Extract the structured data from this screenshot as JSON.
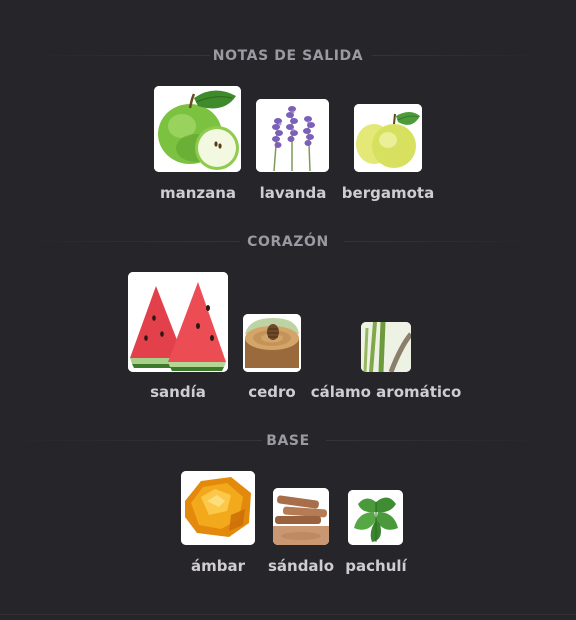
{
  "sections": [
    {
      "title": "NOTAS DE SALIDA",
      "notes": [
        {
          "name": "manzana",
          "icon": "green-apple-icon"
        },
        {
          "name": "lavanda",
          "icon": "lavender-icon"
        },
        {
          "name": "bergamota",
          "icon": "bergamot-icon"
        }
      ]
    },
    {
      "title": "CORAZÓN",
      "notes": [
        {
          "name": "sandía",
          "icon": "watermelon-icon"
        },
        {
          "name": "cedro",
          "icon": "cedar-icon"
        },
        {
          "name": "cálamo aromático",
          "icon": "calamus-icon"
        }
      ]
    },
    {
      "title": "BASE",
      "notes": [
        {
          "name": "ámbar",
          "icon": "amber-icon"
        },
        {
          "name": "sándalo",
          "icon": "sandalwood-icon"
        },
        {
          "name": "pachulí",
          "icon": "patchouli-icon"
        }
      ]
    }
  ],
  "colors": {
    "background": "#262529",
    "header_text": "#9b9aa3",
    "label_text": "#cfcdd3"
  }
}
